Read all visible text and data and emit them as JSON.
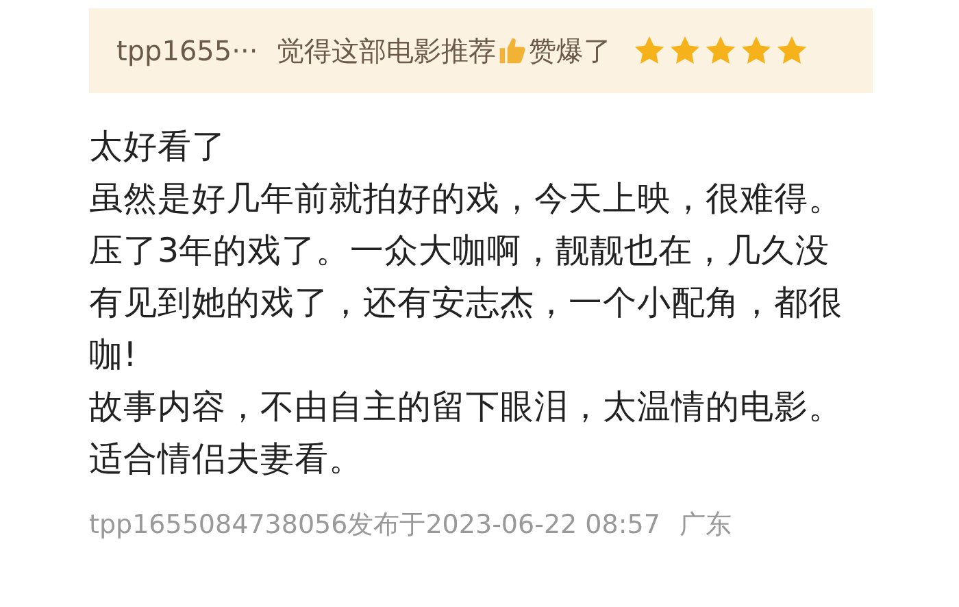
{
  "rating_banner": {
    "username": "tpp1655···",
    "verdict_before": "觉得这部电影推荐",
    "verdict_after": "赞爆了",
    "stars": 5
  },
  "review": {
    "title": "太好看了",
    "paragraphs": [
      "虽然是好几年前就拍好的戏，今天上映，很难得。",
      "压了3年的戏了。一众大咖啊，靓靓也在，几久没有见到她的戏了，还有安志杰，一个小配角，都很咖!",
      "故事内容，不由自主的留下眼泪，太温情的电影。适合情侣夫妻看。"
    ]
  },
  "footer": {
    "posted": "tpp1655084738056发布于2023-06-22 08:57",
    "location": "广东"
  }
}
